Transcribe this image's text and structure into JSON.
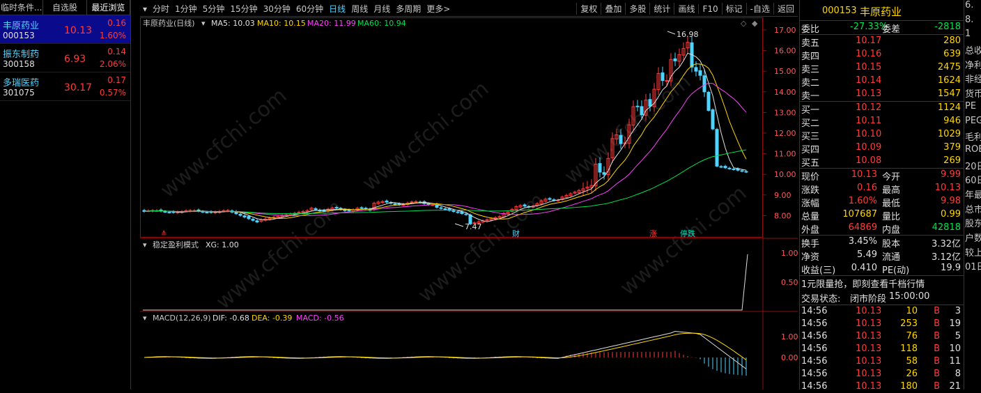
{
  "left_panel": {
    "tabs": [
      "临时条件...",
      "自选股",
      "最近浏览"
    ],
    "stocks": [
      {
        "name": "丰原药业",
        "code": "000153",
        "price": "10.13",
        "change": "0.16",
        "pct": "1.60%"
      },
      {
        "name": "振东制药",
        "code": "300158",
        "price": "6.93",
        "change": "0.14",
        "pct": "2.06%"
      },
      {
        "name": "多瑞医药",
        "code": "301075",
        "price": "30.17",
        "change": "0.17",
        "pct": "0.57%"
      }
    ]
  },
  "toolbar": {
    "periods": [
      "分时",
      "1分钟",
      "5分钟",
      "15分钟",
      "30分钟",
      "60分钟",
      "日线",
      "周线",
      "月线",
      "多周期",
      "更多>"
    ],
    "active": "日线",
    "tools": [
      "复权",
      "叠加",
      "多股",
      "统计",
      "画线",
      "F10",
      "标记",
      "-自选",
      "返回"
    ]
  },
  "main_chart": {
    "title": "丰原药业(日线)",
    "ma": [
      {
        "label": "MA5: 10.03",
        "color": "#e0e0e0"
      },
      {
        "label": "MA10: 10.15",
        "color": "#ffd700"
      },
      {
        "label": "MA20: 11.99",
        "color": "#ff40ff"
      },
      {
        "label": "MA60: 10.94",
        "color": "#00e050"
      }
    ],
    "y_ticks": [
      "17.00",
      "16.00",
      "15.00",
      "14.00",
      "13.00",
      "12.00",
      "11.00",
      "10.00",
      "9.00",
      "8.00"
    ],
    "high_label": "16.98",
    "low_label": "7.47",
    "markers": [
      {
        "text": "财",
        "color": "#4fd3ff"
      },
      {
        "text": "涨",
        "color": "#ff3b3b"
      },
      {
        "text": "停跌",
        "color": "#00e0c0"
      }
    ]
  },
  "indicator1": {
    "title": "稳定盈利模式",
    "xg": "XG: 1.00",
    "y_ticks": [
      "1.00",
      "0.50"
    ]
  },
  "indicator2": {
    "title": "MACD(12,26,9)",
    "dif": "DIF: -0.68",
    "dea": "DEA: -0.39",
    "macd": "MACD: -0.56",
    "y_ticks": [
      "1.00",
      "0.00"
    ]
  },
  "quote": {
    "code": "000153",
    "name": "丰原药业",
    "weibi": {
      "label": "委比",
      "value": "-27.33%",
      "label2": "委差",
      "value2": "-2818"
    },
    "sell": [
      {
        "label": "卖五",
        "price": "10.17",
        "vol": "280"
      },
      {
        "label": "卖四",
        "price": "10.16",
        "vol": "639"
      },
      {
        "label": "卖三",
        "price": "10.15",
        "vol": "2475"
      },
      {
        "label": "卖二",
        "price": "10.14",
        "vol": "1624"
      },
      {
        "label": "卖一",
        "price": "10.13",
        "vol": "1547"
      }
    ],
    "buy": [
      {
        "label": "买一",
        "price": "10.12",
        "vol": "1124"
      },
      {
        "label": "买二",
        "price": "10.11",
        "vol": "946"
      },
      {
        "label": "买三",
        "price": "10.10",
        "vol": "1029"
      },
      {
        "label": "买四",
        "price": "10.09",
        "vol": "379"
      },
      {
        "label": "买五",
        "price": "10.08",
        "vol": "269"
      }
    ],
    "stats": [
      {
        "l1": "现价",
        "v1": "10.13",
        "l2": "今开",
        "v2": "9.99",
        "c1": "red",
        "c2": "red"
      },
      {
        "l1": "涨跌",
        "v1": "0.16",
        "l2": "最高",
        "v2": "10.13",
        "c1": "red",
        "c2": "red"
      },
      {
        "l1": "涨幅",
        "v1": "1.60%",
        "l2": "最低",
        "v2": "9.98",
        "c1": "red",
        "c2": "red"
      },
      {
        "l1": "总量",
        "v1": "107687",
        "l2": "量比",
        "v2": "0.99",
        "c1": "ylw",
        "c2": "ylw"
      },
      {
        "l1": "外盘",
        "v1": "64869",
        "l2": "内盘",
        "v2": "42818",
        "c1": "red",
        "c2": "grn"
      }
    ],
    "stats2": [
      {
        "l1": "换手",
        "v1": "3.45%",
        "l2": "股本",
        "v2": "3.32亿"
      },
      {
        "l1": "净资",
        "v1": "5.49",
        "l2": "流通",
        "v2": "3.12亿"
      },
      {
        "l1": "收益(三)",
        "v1": "0.410",
        "l2": "PE(动)",
        "v2": "19.9"
      }
    ],
    "promo": "1元限量抢，即刻查看千档行情",
    "status_label": "交易状态:",
    "status": "闭市阶段",
    "status_time": "15:00:00",
    "ticks": [
      {
        "t": "14:56",
        "p": "10.13",
        "v": "10",
        "s": "B",
        "n": "3"
      },
      {
        "t": "14:56",
        "p": "10.13",
        "v": "253",
        "s": "B",
        "n": "19"
      },
      {
        "t": "14:56",
        "p": "10.13",
        "v": "76",
        "s": "B",
        "n": "5"
      },
      {
        "t": "14:56",
        "p": "10.13",
        "v": "118",
        "s": "B",
        "n": "10"
      },
      {
        "t": "14:56",
        "p": "10.13",
        "v": "58",
        "s": "B",
        "n": "11"
      },
      {
        "t": "14:56",
        "p": "10.13",
        "v": "26",
        "s": "B",
        "n": "8"
      },
      {
        "t": "14:56",
        "p": "10.13",
        "v": "180",
        "s": "B",
        "n": "21"
      }
    ]
  },
  "edge_texts": [
    "6.",
    "8.",
    "1",
    "总收",
    "净利",
    "非经",
    "货币",
    "PE",
    "PEG",
    "毛利",
    "ROE",
    "20日",
    "60日",
    "年最",
    "总市",
    "股东",
    "户数",
    "较上",
    "01日"
  ],
  "watermark": "www.cfchi.com"
}
